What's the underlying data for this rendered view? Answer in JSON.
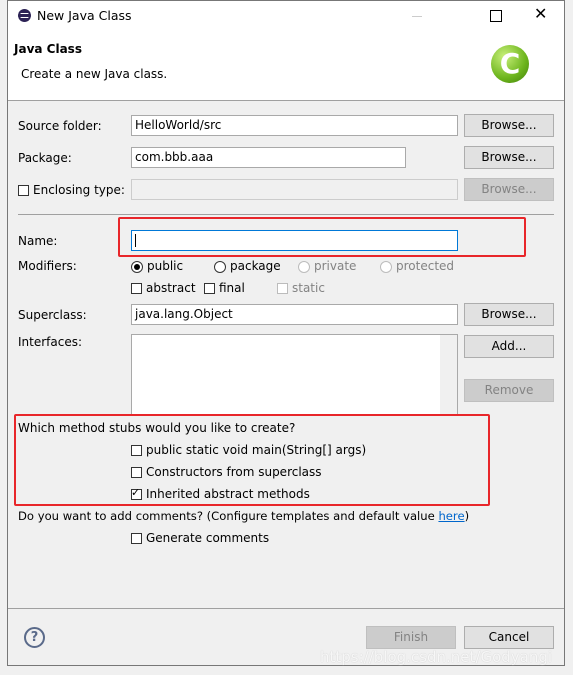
{
  "window": {
    "title": "New Java Class"
  },
  "header": {
    "title": "Java Class",
    "subtitle": "Create a new Java class."
  },
  "form": {
    "source_folder": {
      "label": "Source folder:",
      "value": "HelloWorld/src",
      "browse": "Browse..."
    },
    "package": {
      "label": "Package:",
      "value": "com.bbb.aaa",
      "browse": "Browse..."
    },
    "enclosing_type": {
      "label": "Enclosing type:",
      "checked": false,
      "value": "",
      "browse": "Browse..."
    },
    "name": {
      "label": "Name:",
      "value": ""
    },
    "modifiers": {
      "label": "Modifiers:",
      "public": "public",
      "package": "package",
      "private": "private",
      "protected": "protected",
      "selected": "public",
      "abstract": "abstract",
      "final": "final",
      "static": "static"
    },
    "superclass": {
      "label": "Superclass:",
      "value": "java.lang.Object",
      "browse": "Browse..."
    },
    "interfaces": {
      "label": "Interfaces:",
      "add": "Add...",
      "remove": "Remove"
    },
    "stubs": {
      "question": "Which method stubs would you like to create?",
      "main": "public static void main(String[] args)",
      "main_checked": false,
      "constructors": "Constructors from superclass",
      "constructors_checked": false,
      "inherited": "Inherited abstract methods",
      "inherited_checked": true
    },
    "comments": {
      "question": "Do you want to add comments? (Configure templates and default value ",
      "link": "here",
      "close": ")",
      "generate": "Generate comments",
      "generate_checked": false
    }
  },
  "footer": {
    "finish": "Finish",
    "cancel": "Cancel"
  },
  "watermark": "https://blog.csdn.net/Godyangi"
}
